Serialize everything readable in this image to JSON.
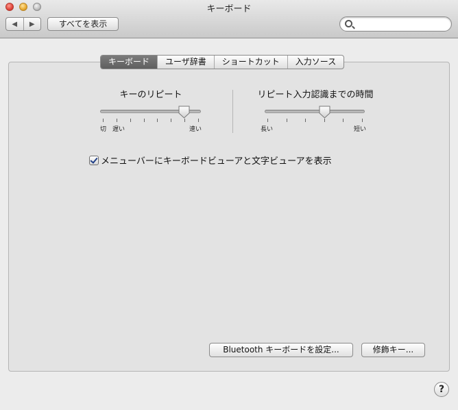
{
  "window": {
    "title": "キーボード"
  },
  "toolbar": {
    "back_glyph": "◀",
    "forward_glyph": "▶",
    "show_all_label": "すべてを表示",
    "search": {
      "value": "",
      "placeholder": ""
    }
  },
  "tabs": [
    {
      "label": "キーボード",
      "selected": true
    },
    {
      "label": "ユーザ辞書",
      "selected": false
    },
    {
      "label": "ショートカット",
      "selected": false
    },
    {
      "label": "入力ソース",
      "selected": false
    }
  ],
  "key_repeat": {
    "title": "キーのリピート",
    "labels": {
      "off": "切",
      "slow": "遅い",
      "fast": "速い"
    },
    "value_fraction": 0.83
  },
  "repeat_delay": {
    "title": "リピート入力認識までの時間",
    "labels": {
      "long": "長い",
      "short": "短い"
    },
    "value_fraction": 0.6
  },
  "show_viewer_checkbox": {
    "label": "メニューバーにキーボードビューアと文字ビューアを表示",
    "checked": true
  },
  "buttons": {
    "bluetooth_setup": "Bluetooth キーボードを設定...",
    "modifier_keys": "修飾キー..."
  },
  "help": {
    "label": "?"
  },
  "colors": {
    "accent": "#1e3e86",
    "selected_tab": "#6d6d6d"
  }
}
